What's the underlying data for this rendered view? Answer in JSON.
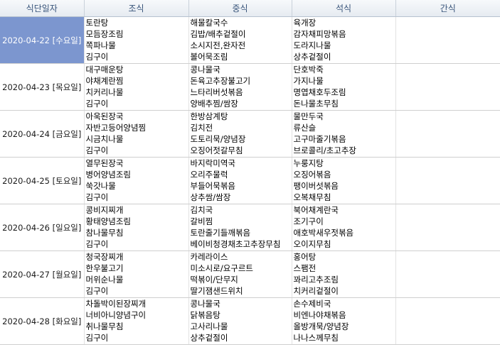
{
  "headers": [
    "식단일자",
    "조식",
    "중식",
    "석식",
    "간식"
  ],
  "colors": {
    "header_text": "#38547a",
    "selected_row_bg": "#7c96cf",
    "selected_row_text": "#ffffff"
  },
  "selected_row": 0,
  "rows": [
    {
      "date": "2020-04-22 [수요일]",
      "breakfast": [
        "토란탕",
        "모듬장조림",
        "쪽파나물",
        "김구이"
      ],
      "lunch": [
        "해물칼국수",
        "김밥/배추겉절이",
        "소시지전,완자전",
        "볼어묵조림"
      ],
      "dinner": [
        "육개장",
        "감자채피망볶음",
        "도라지나물",
        "상추겉절이"
      ],
      "snack": []
    },
    {
      "date": "2020-04-23 [목요일]",
      "breakfast": [
        "대구매운탕",
        "야채계란찜",
        "치커리나물",
        "김구이"
      ],
      "lunch": [
        "콩나물국",
        "돈육고추장불고기",
        "느타리버섯볶음",
        "양배추찜/쌈장"
      ],
      "dinner": [
        "단호박죽",
        "가지나물",
        "명엽채호두조림",
        "돈나물초무침"
      ],
      "snack": []
    },
    {
      "date": "2020-04-24 [금요일]",
      "breakfast": [
        "아욱된장국",
        "자반고등어양념찜",
        "시금치나물",
        "김구이"
      ],
      "lunch": [
        "한방삼계탕",
        "김치전",
        "도토리묵/양념장",
        "오징어젓갈무침"
      ],
      "dinner": [
        "물만두국",
        "류산슬",
        "고구마줄기볶음",
        "브로콜리/초고추장"
      ],
      "snack": []
    },
    {
      "date": "2020-04-25 [토요일]",
      "breakfast": [
        "열무된장국",
        "병어양념조림",
        "쑥갓나물",
        "김구이"
      ],
      "lunch": [
        "바지락미역국",
        "오리주물럭",
        "부들어묵볶음",
        "상추쌈/쌈장"
      ],
      "dinner": [
        "누룽지탕",
        "오징어볶음",
        "팽이버섯볶음",
        "오복채무침"
      ],
      "snack": []
    },
    {
      "date": "2020-04-26 [일요일]",
      "breakfast": [
        "콩비지찌개",
        "황태양념조림",
        "참나물무침",
        "김구이"
      ],
      "lunch": [
        "김치국",
        "갈비찜",
        "토란줄기들깨볶음",
        "베이비청경채초고추장무침"
      ],
      "dinner": [
        "북어채계란국",
        "조기구이",
        "애호박새우젓볶음",
        "오이지무침"
      ],
      "snack": []
    },
    {
      "date": "2020-04-27 [월요일]",
      "breakfast": [
        "청국장찌개",
        "한우불고기",
        "머위순나물",
        "김구이"
      ],
      "lunch": [
        "카레라이스",
        "미소시로/요구르트",
        "떡볶이/단무지",
        "딸기잼샌드위치"
      ],
      "dinner": [
        "홍어탕",
        "스팸전",
        "꽈리고추조림",
        "치커리겉절이"
      ],
      "snack": []
    },
    {
      "date": "2020-04-28 [화요일]",
      "breakfast": [
        "차돌박이된장찌개",
        "너비아니양념구이",
        "취나물무침",
        "김구이"
      ],
      "lunch": [
        "콩나물국",
        "닭볶음탕",
        "고사리나물",
        "상추겉절이"
      ],
      "dinner": [
        "손수제비국",
        "비엔나야채볶음",
        "올방개묵/양념장",
        "나나스께무침"
      ],
      "snack": []
    }
  ]
}
